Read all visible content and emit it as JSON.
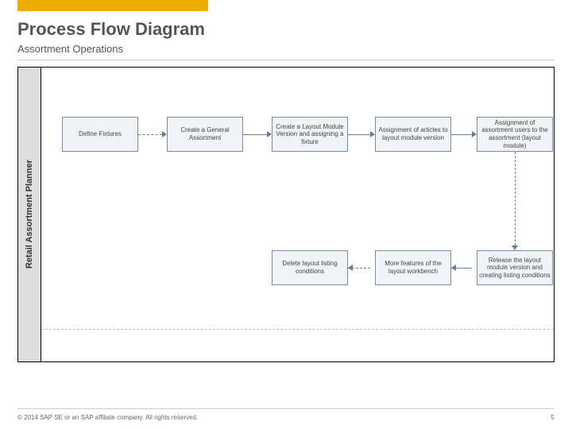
{
  "header": {
    "title": "Process Flow Diagram",
    "subtitle": "Assortment Operations"
  },
  "lane": {
    "label": "Retail Assortment Planner"
  },
  "boxes": {
    "b1": "Define Fixtures",
    "b2": "Create a General Assortment",
    "b3": "Create a  Layout Module Version and assigning a fixture",
    "b4": "Assignment of articles to layout module version",
    "b5": "Assignment of assortment users to the assortment (layout module)",
    "b6": "Delete layout listing conditions",
    "b7": "More features of the layout workbench",
    "b8": "Release the layout module version and creating listing conditions"
  },
  "footer": {
    "copyright": "© 2014 SAP SE or an SAP affiliate company. All rights reserved.",
    "page": "5"
  },
  "chart_data": {
    "type": "flowchart",
    "title": "Process Flow Diagram — Assortment Operations",
    "swimlanes": [
      {
        "id": "lane1",
        "label": "Retail Assortment Planner"
      }
    ],
    "nodes": [
      {
        "id": "b1",
        "lane": "lane1",
        "label": "Define Fixtures"
      },
      {
        "id": "b2",
        "lane": "lane1",
        "label": "Create a General Assortment"
      },
      {
        "id": "b3",
        "lane": "lane1",
        "label": "Create a Layout Module Version and assigning a fixture"
      },
      {
        "id": "b4",
        "lane": "lane1",
        "label": "Assignment of articles to layout module version"
      },
      {
        "id": "b5",
        "lane": "lane1",
        "label": "Assignment of assortment users to the assortment (layout module)"
      },
      {
        "id": "b6",
        "lane": "lane1",
        "label": "Delete layout listing conditions"
      },
      {
        "id": "b7",
        "lane": "lane1",
        "label": "More features of the layout workbench"
      },
      {
        "id": "b8",
        "lane": "lane1",
        "label": "Release the layout module version and creating listing conditions"
      }
    ],
    "edges": [
      {
        "from": "b1",
        "to": "b2",
        "style": "dashed"
      },
      {
        "from": "b2",
        "to": "b3",
        "style": "solid"
      },
      {
        "from": "b3",
        "to": "b4",
        "style": "solid"
      },
      {
        "from": "b4",
        "to": "b5",
        "style": "solid"
      },
      {
        "from": "b5",
        "to": "b8",
        "style": "dashed"
      },
      {
        "from": "b8",
        "to": "b7",
        "style": "solid"
      },
      {
        "from": "b7",
        "to": "b6",
        "style": "dashed"
      }
    ]
  }
}
